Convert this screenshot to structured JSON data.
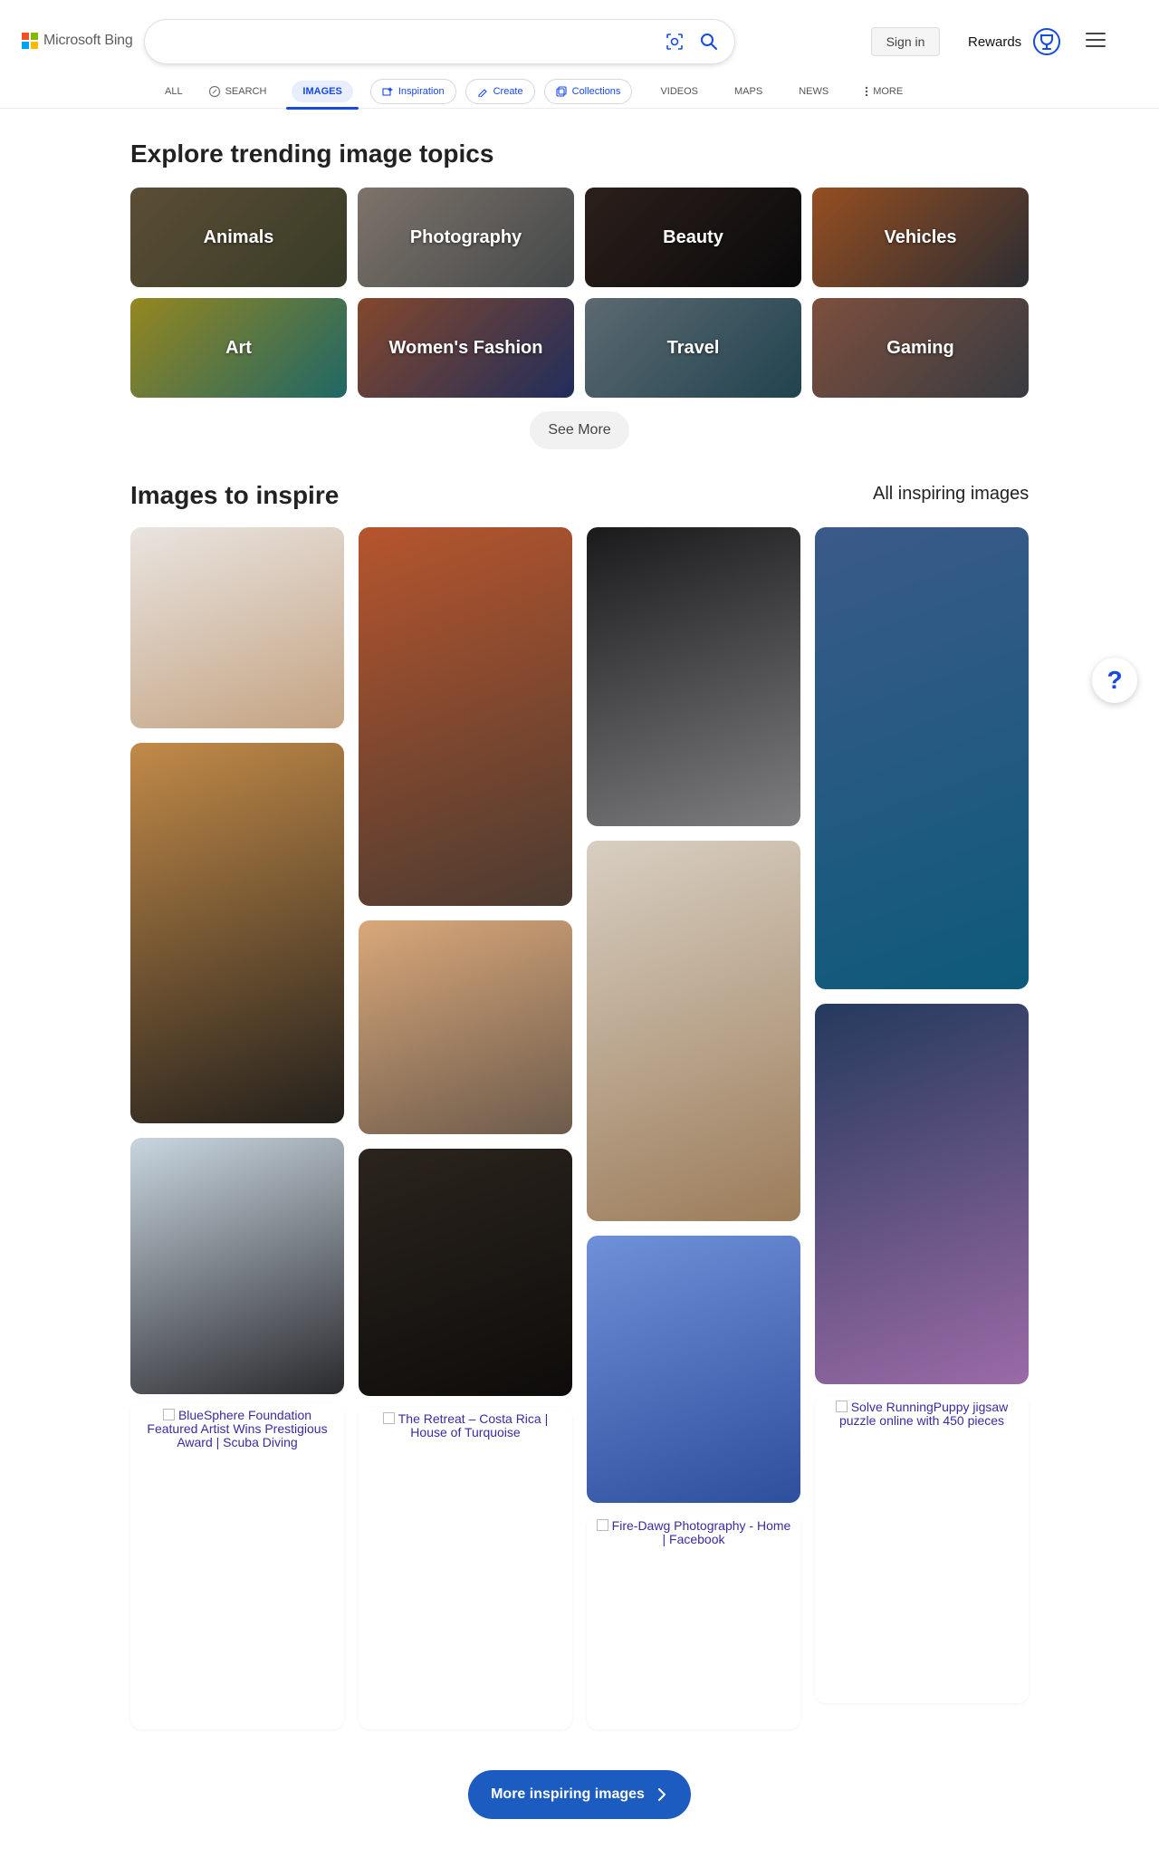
{
  "header": {
    "logo_text": "Microsoft Bing",
    "sign_in": "Sign in",
    "rewards_label": "Rewards",
    "search_value": ""
  },
  "tabs": [
    {
      "label": "ALL"
    },
    {
      "label": "SEARCH"
    },
    {
      "label": "IMAGES",
      "active": true
    },
    {
      "label": "Inspiration"
    },
    {
      "label": "Create"
    },
    {
      "label": "Collections"
    },
    {
      "label": "VIDEOS"
    },
    {
      "label": "MAPS"
    },
    {
      "label": "NEWS"
    },
    {
      "label": "MORE"
    }
  ],
  "trending": {
    "title": "Explore trending image topics",
    "topics": [
      {
        "label": "Animals",
        "colors": [
          "#7a6848",
          "#4b4f33"
        ]
      },
      {
        "label": "Photography",
        "colors": [
          "#a89a8e",
          "#5a6062"
        ]
      },
      {
        "label": "Beauty",
        "colors": [
          "#3b2a24",
          "#0d0d0f"
        ]
      },
      {
        "label": "Vehicles",
        "colors": [
          "#c8692c",
          "#3a3d44"
        ]
      },
      {
        "label": "Art",
        "colors": [
          "#c8b42a",
          "#2a8a88"
        ]
      },
      {
        "label": "Women's Fashion",
        "colors": [
          "#b0603a",
          "#2c3d7a"
        ]
      },
      {
        "label": "Travel",
        "colors": [
          "#7c8d97",
          "#2c5a6a"
        ]
      },
      {
        "label": "Gaming",
        "colors": [
          "#a86a52",
          "#4a4f57"
        ]
      }
    ],
    "see_more": "See More"
  },
  "inspire": {
    "title": "Images to inspire",
    "all_link": "All inspiring images",
    "more_button": "More inspiring images"
  },
  "columns": [
    {
      "cards": [
        {
          "name": "puppy-card",
          "colors": [
            "#e9e4e0",
            "#c4a382"
          ]
        },
        {
          "name": "sportscar-jet-card",
          "colors": [
            "#c28a48",
            "#23201c"
          ]
        },
        {
          "name": "doberman-card",
          "colors": [
            "#c9d6e0",
            "#2a2a2e"
          ]
        }
      ],
      "broken": "BlueSphere Foundation Featured Artist Wins Prestigious Award | Scuba Diving"
    },
    {
      "cards": [
        {
          "name": "autumn-dock-card",
          "colors": [
            "#b6552e",
            "#4b3b30"
          ]
        },
        {
          "name": "tiger-cub-card",
          "colors": [
            "#d9a87a",
            "#6d5b4c"
          ]
        },
        {
          "name": "butterfly-portrait-card",
          "colors": [
            "#2b241e",
            "#0e0c0a"
          ]
        }
      ],
      "broken": "The Retreat – Costa Rica | House of Turquoise"
    },
    {
      "cards": [
        {
          "name": "space-ballerina-card",
          "colors": [
            "#1a1a1c",
            "#7e7e80"
          ]
        },
        {
          "name": "snowy-dog-card",
          "colors": [
            "#d8cfc2",
            "#9c7c5a"
          ]
        },
        {
          "name": "shiba-flowers-card",
          "colors": [
            "#6f91d9",
            "#2d4f9c"
          ]
        }
      ],
      "broken": "Fire-Dawg Photography - Home | Facebook"
    },
    {
      "cards": [
        {
          "name": "tropical-resort-card",
          "colors": [
            "#3b5a8a",
            "#0e5a7a"
          ]
        },
        {
          "name": "glitter-face-card",
          "colors": [
            "#243a5c",
            "#9b6aa6"
          ]
        }
      ],
      "broken": "Solve RunningPuppy jigsaw puzzle online with 450 pieces"
    }
  ],
  "help_label": "?"
}
